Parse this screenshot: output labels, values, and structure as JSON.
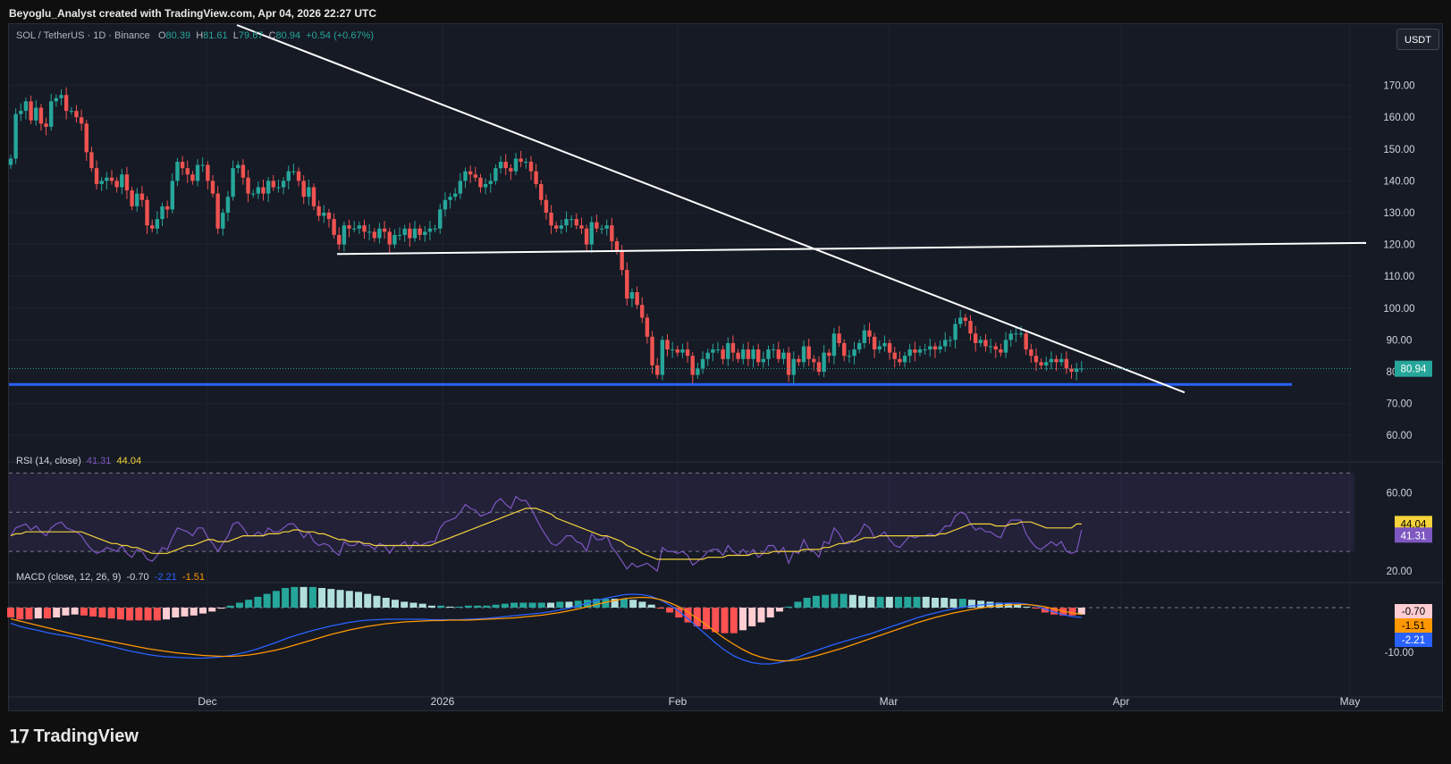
{
  "credit": "Beyoglu_Analyst created with TradingView.com, Apr 04, 2026 22:27 UTC",
  "legend": {
    "symbol": "SOL / TetherUS · 1D · Binance",
    "o_label": "O",
    "o": "80.39",
    "h_label": "H",
    "h": "81.61",
    "l_label": "L",
    "l": "79.67",
    "c_label": "C",
    "c": "80.94",
    "change": "+0.54 (+0.67%)"
  },
  "currency_button": "USDT",
  "rsi_legend": {
    "name": "RSI (14, close)",
    "rsi": "41.31",
    "ma": "44.04"
  },
  "macd_legend": {
    "name": "MACD (close, 12, 26, 9)",
    "hist": "-0.70",
    "macd": "-2.21",
    "signal": "-1.51"
  },
  "footer": {
    "brand": "TradingView"
  },
  "colors": {
    "up": "#26a69a",
    "down": "#ef5350",
    "rsi": "#7e57c2",
    "rsi_ma": "#f5d33a",
    "macd": "#2962ff",
    "signal": "#ff9800",
    "support": "#2962ff",
    "trendline": "#ffffff"
  },
  "chart_data": [
    {
      "type": "candlestick",
      "title": "SOL / TetherUS · 1D · Binance",
      "ylim": [
        55,
        180
      ],
      "y_ticks": [
        60,
        70,
        80,
        90,
        100,
        110,
        120,
        130,
        140,
        150,
        160,
        170
      ],
      "y_tick_labels": [
        "60.00",
        "70.00",
        "80.00",
        "90.00",
        "100.00",
        "110.00",
        "120.00",
        "130.00",
        "140.00",
        "150.00",
        "160.00",
        "170.00"
      ],
      "x_tick_labels": [
        "Dec",
        "2026",
        "Feb",
        "Mar",
        "Apr",
        "May"
      ],
      "last_price_label": "80.94",
      "close": [
        147,
        161,
        162,
        165,
        159,
        163,
        158,
        157,
        165,
        166,
        167,
        162,
        162,
        160,
        158,
        149,
        144,
        139,
        140,
        141,
        140,
        138,
        142,
        137,
        132,
        136,
        134,
        126,
        125,
        128,
        132,
        131,
        140,
        146,
        144,
        142,
        140,
        145,
        145,
        140,
        136,
        125,
        130,
        135,
        144,
        145,
        141,
        136,
        136,
        138,
        136,
        140,
        138,
        138,
        140,
        143,
        143,
        140,
        135,
        138,
        132,
        129,
        130,
        128,
        123,
        120,
        126,
        125,
        125,
        126,
        124,
        124,
        122,
        125,
        124,
        120,
        123,
        123,
        125,
        122,
        125,
        123,
        124,
        125,
        125,
        131,
        134,
        135,
        136,
        140,
        143,
        142,
        141,
        138,
        139,
        140,
        144,
        146,
        144,
        143,
        147,
        146,
        146,
        143,
        139,
        134,
        130,
        126,
        125,
        126,
        128,
        128,
        126,
        125,
        120,
        127,
        125,
        125,
        126,
        121,
        118,
        112,
        103,
        105,
        101,
        97,
        91,
        82,
        79,
        90,
        87,
        87,
        86,
        87,
        85,
        79,
        81,
        84,
        86,
        87,
        87,
        84,
        89,
        86,
        84,
        87,
        84,
        87,
        83,
        84,
        87,
        87,
        84,
        86,
        79,
        84,
        83,
        88,
        84,
        83,
        80,
        86,
        85,
        92,
        89,
        85,
        85,
        87,
        89,
        93,
        91,
        87,
        88,
        89,
        86,
        84,
        83,
        85,
        87,
        86,
        87,
        87,
        88,
        87,
        88,
        90,
        90,
        95,
        97,
        96,
        92,
        89,
        90,
        88,
        88,
        87,
        86,
        90,
        92,
        92,
        92,
        87,
        85,
        83,
        82,
        83,
        84,
        83,
        84,
        81,
        80,
        81,
        81
      ],
      "support_level": 76,
      "resistance_level": 119
    },
    {
      "type": "line",
      "name": "RSI (14, close)",
      "ylim": [
        15,
        72
      ],
      "y_ticks": [
        20,
        60
      ],
      "y_tick_labels": [
        "20.00",
        "60.00"
      ],
      "bands": [
        30,
        50,
        70
      ],
      "rsi_last": 41.31,
      "ma_last": 44.04,
      "rsi": [
        38,
        42,
        43,
        44,
        41,
        43,
        40,
        38,
        42,
        44,
        45,
        42,
        41,
        40,
        38,
        34,
        31,
        29,
        30,
        32,
        31,
        30,
        33,
        29,
        27,
        31,
        30,
        26,
        25,
        28,
        32,
        31,
        37,
        42,
        41,
        40,
        38,
        42,
        42,
        37,
        34,
        30,
        34,
        38,
        44,
        45,
        42,
        38,
        38,
        40,
        38,
        42,
        40,
        40,
        42,
        44,
        44,
        41,
        37,
        40,
        35,
        33,
        34,
        33,
        30,
        28,
        35,
        33,
        33,
        35,
        33,
        33,
        31,
        34,
        33,
        29,
        33,
        33,
        35,
        31,
        35,
        33,
        34,
        35,
        35,
        42,
        45,
        46,
        47,
        50,
        54,
        52,
        51,
        48,
        49,
        50,
        55,
        57,
        54,
        52,
        58,
        56,
        56,
        52,
        47,
        42,
        38,
        34,
        33,
        35,
        38,
        38,
        35,
        34,
        30,
        39,
        36,
        36,
        38,
        32,
        29,
        25,
        21,
        24,
        22,
        23,
        24,
        22,
        20,
        32,
        30,
        30,
        29,
        30,
        28,
        23,
        25,
        27,
        30,
        31,
        31,
        28,
        33,
        30,
        28,
        31,
        28,
        31,
        27,
        29,
        33,
        33,
        29,
        32,
        24,
        30,
        29,
        36,
        31,
        30,
        27,
        35,
        34,
        42,
        39,
        34,
        34,
        37,
        39,
        44,
        42,
        37,
        38,
        40,
        36,
        33,
        32,
        35,
        38,
        37,
        38,
        38,
        39,
        38,
        40,
        43,
        43,
        48,
        50,
        49,
        44,
        41,
        42,
        40,
        40,
        38,
        37,
        43,
        46,
        46,
        46,
        39,
        35,
        32,
        31,
        33,
        35,
        33,
        35,
        30,
        29,
        30,
        41
      ],
      "rsi_ma": [
        38,
        39,
        39,
        40,
        40,
        40,
        40,
        40,
        40,
        40,
        40,
        40,
        40,
        40,
        40,
        39,
        38,
        37,
        36,
        35,
        34,
        34,
        33,
        33,
        32,
        32,
        31,
        30,
        29,
        29,
        29,
        29,
        30,
        31,
        32,
        33,
        33,
        34,
        35,
        36,
        36,
        35,
        35,
        35,
        36,
        37,
        38,
        38,
        38,
        38,
        38,
        39,
        39,
        39,
        40,
        40,
        41,
        41,
        40,
        40,
        40,
        39,
        39,
        38,
        37,
        36,
        36,
        35,
        35,
        35,
        34,
        34,
        33,
        33,
        33,
        33,
        33,
        33,
        33,
        33,
        33,
        33,
        33,
        33,
        34,
        35,
        36,
        37,
        38,
        39,
        40,
        41,
        42,
        43,
        44,
        45,
        46,
        47,
        48,
        49,
        50,
        51,
        52,
        52,
        52,
        51,
        50,
        49,
        47,
        46,
        45,
        44,
        43,
        42,
        41,
        40,
        39,
        38,
        38,
        37,
        36,
        35,
        33,
        32,
        31,
        29,
        28,
        27,
        26,
        26,
        26,
        26,
        26,
        26,
        26,
        26,
        26,
        26,
        27,
        27,
        27,
        27,
        28,
        28,
        28,
        28,
        28,
        29,
        29,
        29,
        29,
        30,
        30,
        30,
        30,
        30,
        30,
        31,
        31,
        31,
        31,
        32,
        32,
        33,
        34,
        34,
        35,
        35,
        36,
        37,
        37,
        37,
        38,
        38,
        38,
        38,
        38,
        38,
        38,
        38,
        38,
        38,
        38,
        38,
        39,
        39,
        40,
        41,
        42,
        43,
        44,
        44,
        44,
        44,
        44,
        43,
        43,
        43,
        44,
        44,
        45,
        45,
        45,
        44,
        43,
        42,
        42,
        42,
        42,
        42,
        42,
        44,
        44
      ]
    },
    {
      "type": "bar",
      "name": "MACD (close, 12, 26, 9)",
      "ylim": [
        -13,
        5
      ],
      "y_ticks": [
        -10
      ],
      "y_tick_labels": [
        "-10.00"
      ],
      "hist_last": -0.7,
      "macd_last": -2.21,
      "signal_last": -1.51,
      "macd": [
        -3.5,
        -4.2,
        -4.7,
        -5.1,
        -5.6,
        -6.0,
        -6.3,
        -6.7,
        -7.2,
        -7.7,
        -8.2,
        -8.7,
        -9.2,
        -9.7,
        -10.1,
        -10.5,
        -10.8,
        -11.0,
        -11.1,
        -11.2,
        -11.3,
        -11.3,
        -11.2,
        -11.0,
        -10.7,
        -10.3,
        -9.8,
        -9.2,
        -8.5,
        -7.8,
        -7.0,
        -6.3,
        -5.7,
        -5.1,
        -4.6,
        -4.1,
        -3.7,
        -3.3,
        -3.0,
        -2.8,
        -2.7,
        -2.6,
        -2.6,
        -2.6,
        -2.6,
        -2.6,
        -2.7,
        -2.7,
        -2.7,
        -2.7,
        -2.6,
        -2.5,
        -2.4,
        -2.2,
        -2.0,
        -1.8,
        -1.6,
        -1.4,
        -1.2,
        -0.9,
        -0.5,
        -0.1,
        0.4,
        1.0,
        1.6,
        2.1,
        2.5,
        2.9,
        3.0,
        2.9,
        2.5,
        1.7,
        0.6,
        -0.8,
        -2.5,
        -4.3,
        -6.1,
        -7.9,
        -9.5,
        -10.8,
        -11.7,
        -12.3,
        -12.6,
        -12.6,
        -12.3,
        -11.8,
        -11.1,
        -10.3,
        -9.6,
        -8.9,
        -8.2,
        -7.6,
        -7.0,
        -6.4,
        -5.8,
        -5.1,
        -4.4,
        -3.7,
        -3.0,
        -2.3,
        -1.7,
        -1.2,
        -0.7,
        -0.3,
        0.1,
        0.4,
        0.6,
        0.8,
        0.9,
        1.0,
        1.0,
        0.8,
        0.4,
        -0.3,
        -1.0,
        -1.6,
        -2.0,
        -2.2
      ],
      "signal": [
        -2.5,
        -3.0,
        -3.5,
        -4.0,
        -4.5,
        -5.0,
        -5.5,
        -6.0,
        -6.4,
        -6.8,
        -7.2,
        -7.6,
        -8.0,
        -8.4,
        -8.8,
        -9.2,
        -9.5,
        -9.8,
        -10.1,
        -10.3,
        -10.5,
        -10.7,
        -10.8,
        -10.9,
        -10.9,
        -10.8,
        -10.6,
        -10.3,
        -9.9,
        -9.5,
        -9.0,
        -8.4,
        -7.8,
        -7.2,
        -6.6,
        -6.0,
        -5.5,
        -5.0,
        -4.6,
        -4.2,
        -3.9,
        -3.6,
        -3.4,
        -3.2,
        -3.1,
        -3.0,
        -2.9,
        -2.9,
        -2.8,
        -2.8,
        -2.8,
        -2.7,
        -2.6,
        -2.5,
        -2.4,
        -2.3,
        -2.1,
        -1.9,
        -1.7,
        -1.4,
        -1.1,
        -0.7,
        -0.3,
        0.2,
        0.7,
        1.2,
        1.6,
        2.0,
        2.2,
        2.3,
        2.2,
        1.8,
        1.1,
        0.2,
        -1.0,
        -2.4,
        -3.9,
        -5.4,
        -6.9,
        -8.2,
        -9.4,
        -10.4,
        -11.1,
        -11.6,
        -11.9,
        -11.9,
        -11.7,
        -11.3,
        -10.8,
        -10.2,
        -9.6,
        -9.0,
        -8.3,
        -7.6,
        -6.9,
        -6.2,
        -5.5,
        -4.8,
        -4.1,
        -3.4,
        -2.8,
        -2.2,
        -1.7,
        -1.2,
        -0.8,
        -0.4,
        -0.1,
        0.2,
        0.4,
        0.6,
        0.7,
        0.7,
        0.5,
        0.2,
        -0.3,
        -0.8,
        -1.2,
        -1.5
      ]
    }
  ]
}
